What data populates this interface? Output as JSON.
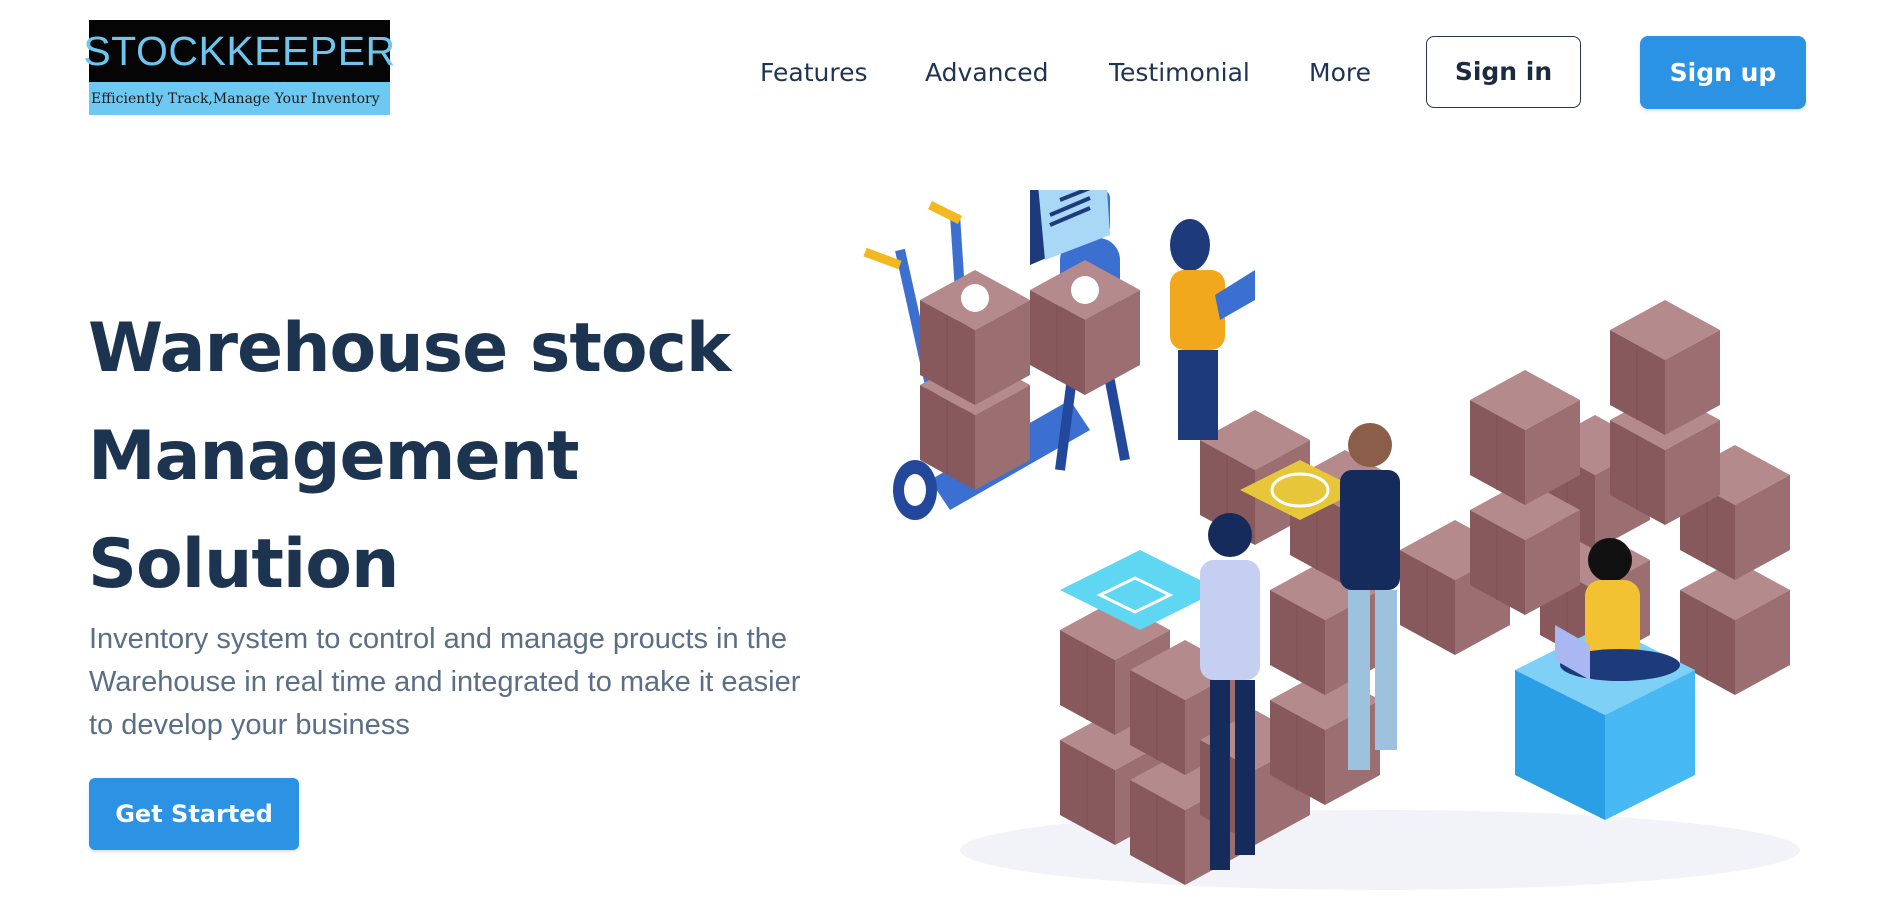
{
  "brand": {
    "name": "STOCKKEEPER",
    "tagline": "Efficiently Track,Manage Your Inventory"
  },
  "nav": {
    "links": [
      "Features",
      "Advanced",
      "Testimonial",
      "More"
    ],
    "sign_in": "Sign in",
    "sign_up": "Sign up"
  },
  "hero": {
    "title_lines": [
      "Warehouse stock",
      "Management",
      "Solution"
    ],
    "subtitle": "Inventory system to control and manage proucts in the Warehouse in real time and integrated to make it easier to develop your business",
    "cta": "Get Started"
  },
  "illustration": {
    "subject": "warehouse-team-illustration",
    "icons": [
      "gear-icon",
      "gear-icon",
      "document-chart-icon",
      "envelope-icon",
      "coin-icon",
      "laptop-icon",
      "laptop-icon"
    ]
  },
  "colors": {
    "primary": "#2c93e4",
    "heading": "#1c3450",
    "text": "#5a6e86",
    "box": "#9b6f72",
    "logo_bg": "#050505",
    "logo_text": "#6cc6ef",
    "logo_band": "#6ec9f2"
  }
}
